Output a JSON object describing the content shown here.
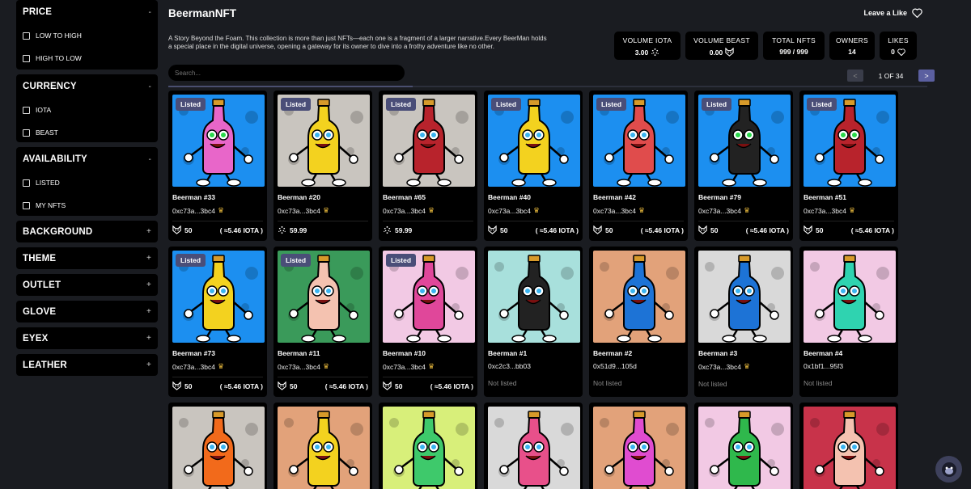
{
  "sidebar": {
    "price": {
      "title": "PRICE",
      "toggle": "-",
      "options": [
        "LOW TO HIGH",
        "HIGH TO LOW"
      ]
    },
    "currency": {
      "title": "CURRENCY",
      "toggle": "-",
      "options": [
        "IOTA",
        "BEAST"
      ]
    },
    "availability": {
      "title": "AVAILABILITY",
      "toggle": "-",
      "options": [
        "LISTED",
        "MY NFTS"
      ]
    },
    "collapsed": [
      {
        "title": "BACKGROUND",
        "toggle": "+"
      },
      {
        "title": "THEME",
        "toggle": "+"
      },
      {
        "title": "OUTLET",
        "toggle": "+"
      },
      {
        "title": "GLOVE",
        "toggle": "+"
      },
      {
        "title": "EYEX",
        "toggle": "+"
      },
      {
        "title": "LEATHER",
        "toggle": "+"
      }
    ]
  },
  "header": {
    "brand": "BeermanNFT",
    "like_label": "Leave a Like",
    "description": "A Story Beyond the Foam. This collection is more than just NFTs—each one is a fragment of a larger narrative.Every BeerMan holds a special place in the digital universe, opening a gateway for its owner to dive into a frothy adventure like no other."
  },
  "stats": [
    {
      "label": "VOLUME IOTA",
      "value": "3.00",
      "icon": "iota-icon"
    },
    {
      "label": "VOLUME BEAST",
      "value": "0.00",
      "icon": "beast-icon"
    },
    {
      "label": "TOTAL NFTS",
      "value": "999 / 999",
      "icon": ""
    },
    {
      "label": "OWNERS",
      "value": "14",
      "icon": ""
    },
    {
      "label": "LIKES",
      "value": "0",
      "icon": "heart-icon"
    }
  ],
  "search": {
    "placeholder": "Search..."
  },
  "pager": {
    "prev": "<",
    "text": "1 OF 34",
    "next": ">"
  },
  "listed_badge": "Listed",
  "colors": {
    "accent": "#5b5fa0",
    "crown": "#e2b43b"
  },
  "cards": [
    {
      "name": "Beerman #33",
      "owner": "0xc73a...3bc4",
      "crown": true,
      "listed": true,
      "price_token": "beast",
      "price": "50",
      "fiat": "( ≈5.46 IOTA )",
      "bg": "#1c8ff0",
      "bottle": "#e866c9",
      "eyes": "#2bd94c"
    },
    {
      "name": "Beerman #20",
      "owner": "0xc73a...3bc4",
      "crown": true,
      "listed": true,
      "price_token": "iota",
      "price": "59.99",
      "fiat": "",
      "bg": "#c9c5bf",
      "bottle": "#f3d21f",
      "eyes": "#3ab4f0"
    },
    {
      "name": "Beerman #65",
      "owner": "0xc73a...3bc4",
      "crown": true,
      "listed": true,
      "price_token": "iota",
      "price": "59.99",
      "fiat": "",
      "bg": "#c9c5bf",
      "bottle": "#b8232c",
      "eyes": "#3ab4f0"
    },
    {
      "name": "Beerman #40",
      "owner": "0xc73a...3bc4",
      "crown": true,
      "listed": true,
      "price_token": "beast",
      "price": "50",
      "fiat": "( ≈5.46 IOTA )",
      "bg": "#1c8ff0",
      "bottle": "#f3d21f",
      "eyes": "#3ab4f0"
    },
    {
      "name": "Beerman #42",
      "owner": "0xc73a...3bc4",
      "crown": true,
      "listed": true,
      "price_token": "beast",
      "price": "50",
      "fiat": "( ≈5.46 IOTA )",
      "bg": "#1c8ff0",
      "bottle": "#e04c4c",
      "eyes": "#3ab4f0"
    },
    {
      "name": "Beerman #79",
      "owner": "0xc73a...3bc4",
      "crown": true,
      "listed": true,
      "price_token": "beast",
      "price": "50",
      "fiat": "( ≈5.46 IOTA )",
      "bg": "#1c8ff0",
      "bottle": "#222222",
      "eyes": "#2bd94c"
    },
    {
      "name": "Beerman #51",
      "owner": "0xc73a...3bc4",
      "crown": true,
      "listed": true,
      "price_token": "beast",
      "price": "50",
      "fiat": "( ≈5.46 IOTA )",
      "bg": "#1c8ff0",
      "bottle": "#b8232c",
      "eyes": "#2bd94c"
    },
    {
      "name": "Beerman #73",
      "owner": "0xc73a...3bc4",
      "crown": true,
      "listed": true,
      "price_token": "beast",
      "price": "50",
      "fiat": "( ≈5.46 IOTA )",
      "bg": "#1c8ff0",
      "bottle": "#f3d21f",
      "eyes": "#3ab4f0"
    },
    {
      "name": "Beerman #11",
      "owner": "0xc73a...3bc4",
      "crown": true,
      "listed": true,
      "price_token": "beast",
      "price": "50",
      "fiat": "( ≈5.46 IOTA )",
      "bg": "#3a9a5a",
      "bottle": "#f4c2b0",
      "eyes": "#3ab4f0"
    },
    {
      "name": "Beerman #10",
      "owner": "0xc73a...3bc4",
      "crown": true,
      "listed": true,
      "price_token": "beast",
      "price": "50",
      "fiat": "( ≈5.46 IOTA )",
      "bg": "#f2c9e4",
      "bottle": "#e0479a",
      "eyes": "#3ab4f0"
    },
    {
      "name": "Beerman #1",
      "owner": "0xc2c3...bb03",
      "crown": false,
      "listed": false,
      "not_listed": "Not listed",
      "bg": "#a8e0dc",
      "bottle": "#222222",
      "eyes": "#3ab4f0"
    },
    {
      "name": "Beerman #2",
      "owner": "0x51d9...105d",
      "crown": false,
      "listed": false,
      "not_listed": "Not listed",
      "bg": "#e2a27a",
      "bottle": "#1d73d6",
      "eyes": "#3ab4f0"
    },
    {
      "name": "Beerman #3",
      "owner": "0xc73a...3bc4",
      "crown": true,
      "listed": false,
      "not_listed": "Not listed",
      "bg": "#d9d9d9",
      "bottle": "#1d73d6",
      "eyes": "#3ab4f0"
    },
    {
      "name": "Beerman #4",
      "owner": "0x1bf1...95f3",
      "crown": false,
      "listed": false,
      "not_listed": "Not listed",
      "bg": "#f2c9e4",
      "bottle": "#2fd3b0",
      "eyes": "#3ab4f0"
    },
    {
      "partial": true,
      "bg": "#c9c5bf",
      "bottle": "#f26a1b",
      "eyes": "#3ab4f0"
    },
    {
      "partial": true,
      "bg": "#e2a27a",
      "bottle": "#f3d21f",
      "eyes": "#3ab4f0"
    },
    {
      "partial": true,
      "bg": "#d8ef7a",
      "bottle": "#3ec96b",
      "eyes": "#3ab4f0"
    },
    {
      "partial": true,
      "bg": "#d9d9d9",
      "bottle": "#e8508a",
      "eyes": "#3ab4f0"
    },
    {
      "partial": true,
      "bg": "#e2a27a",
      "bottle": "#e04cd0",
      "eyes": "#3ab4f0"
    },
    {
      "partial": true,
      "bg": "#f2c9e4",
      "bottle": "#2fb84c",
      "eyes": "#3ab4f0"
    },
    {
      "partial": true,
      "bg": "#c8334a",
      "bottle": "#f4c2b0",
      "eyes": "#3ab4f0"
    }
  ]
}
